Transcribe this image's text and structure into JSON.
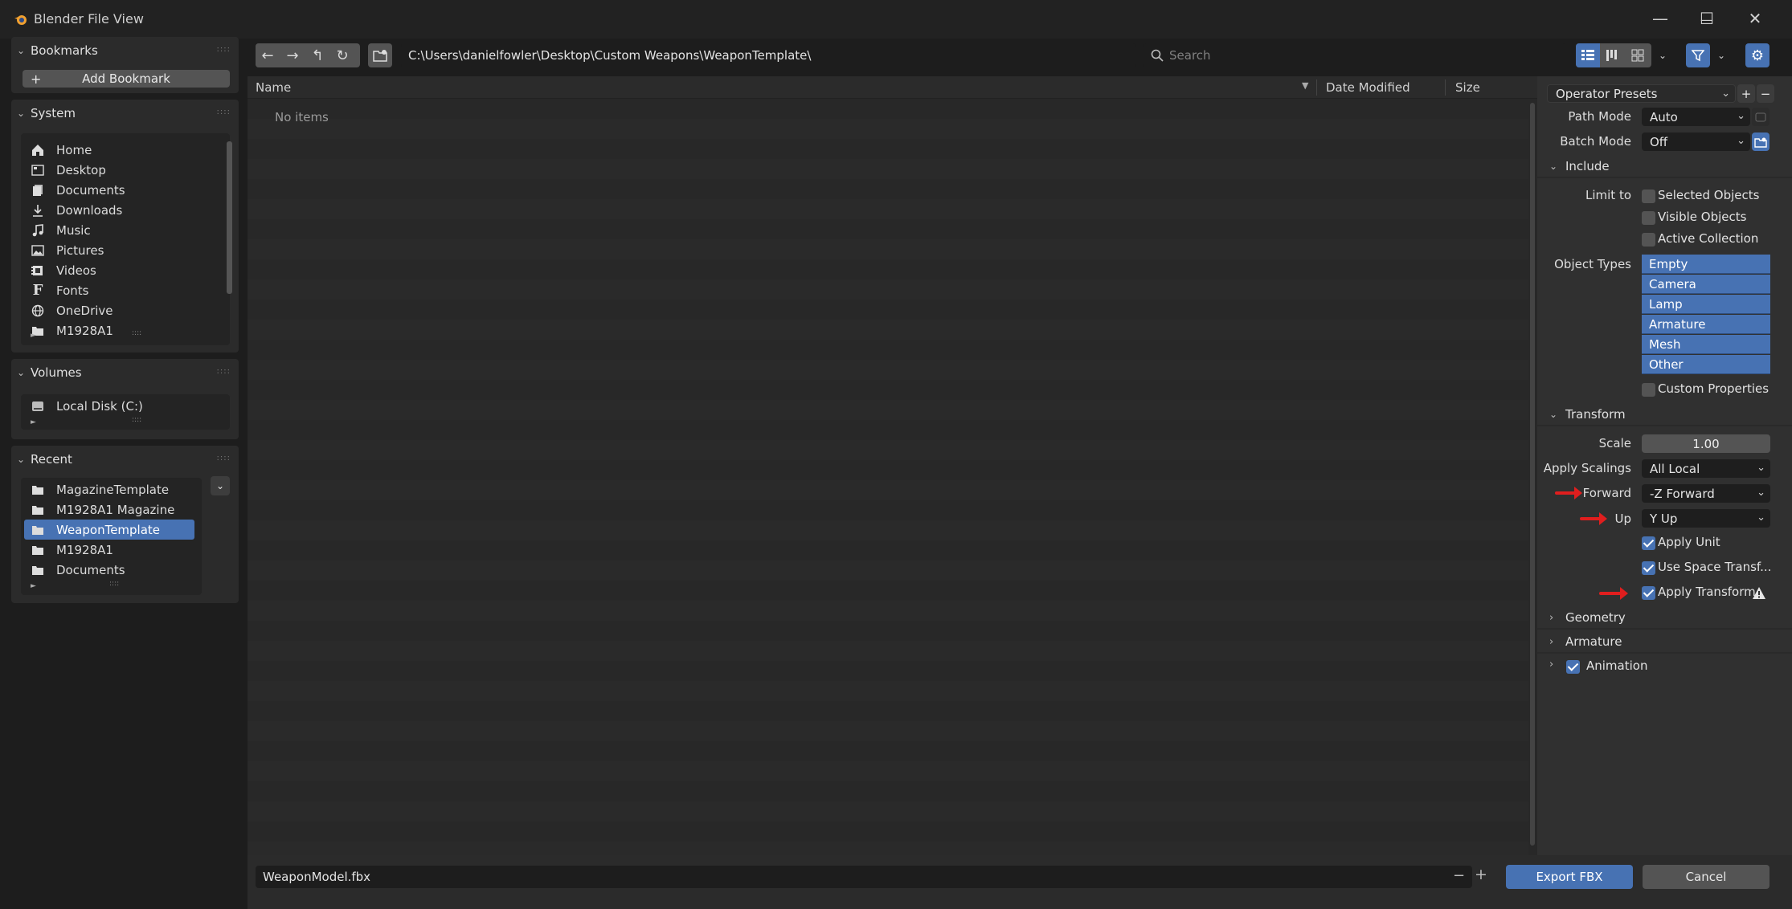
{
  "window": {
    "title": "Blender File View",
    "minimize": "—",
    "maximize": "☐",
    "close": "✕"
  },
  "bookmarks": {
    "title": "Bookmarks",
    "add_label": "Add Bookmark"
  },
  "system": {
    "title": "System",
    "items": [
      {
        "label": "Home",
        "icon": "home-icon"
      },
      {
        "label": "Desktop",
        "icon": "desktop-icon"
      },
      {
        "label": "Documents",
        "icon": "documents-icon"
      },
      {
        "label": "Downloads",
        "icon": "download-icon"
      },
      {
        "label": "Music",
        "icon": "music-icon"
      },
      {
        "label": "Pictures",
        "icon": "image-icon"
      },
      {
        "label": "Videos",
        "icon": "video-icon"
      },
      {
        "label": "Fonts",
        "icon": "font-icon"
      },
      {
        "label": "OneDrive",
        "icon": "globe-icon"
      },
      {
        "label": "M1928A1",
        "icon": "folder-icon"
      }
    ]
  },
  "volumes": {
    "title": "Volumes",
    "items": [
      {
        "label": "Local Disk (C:)",
        "icon": "disk-icon"
      }
    ]
  },
  "recent": {
    "title": "Recent",
    "items": [
      {
        "label": "MagazineTemplate",
        "selected": false
      },
      {
        "label": "M1928A1 Magazine",
        "selected": false
      },
      {
        "label": "WeaponTemplate",
        "selected": true
      },
      {
        "label": "M1928A1",
        "selected": false
      },
      {
        "label": "Documents",
        "selected": false
      }
    ]
  },
  "toolbar": {
    "path": "C:\\Users\\danielfowler\\Desktop\\Custom Weapons\\WeaponTemplate\\",
    "search_placeholder": "Search"
  },
  "filelist": {
    "col_name": "Name",
    "col_date": "Date Modified",
    "col_size": "Size",
    "empty_text": "No items"
  },
  "options": {
    "presets_label": "Operator Presets",
    "path_mode_label": "Path Mode",
    "path_mode_value": "Auto",
    "batch_mode_label": "Batch Mode",
    "batch_mode_value": "Off",
    "include_title": "Include",
    "limit_to_label": "Limit to",
    "selected_objects": "Selected Objects",
    "visible_objects": "Visible Objects",
    "active_collection": "Active Collection",
    "object_types_label": "Object Types",
    "object_types": [
      "Empty",
      "Camera",
      "Lamp",
      "Armature",
      "Mesh",
      "Other"
    ],
    "custom_properties": "Custom Properties",
    "transform_title": "Transform",
    "scale_label": "Scale",
    "scale_value": "1.00",
    "apply_scalings_label": "Apply Scalings",
    "apply_scalings_value": "All Local",
    "forward_label": "Forward",
    "forward_value": "-Z Forward",
    "up_label": "Up",
    "up_value": "Y Up",
    "apply_unit": "Apply Unit",
    "use_space_transform": "Use Space Transf...",
    "apply_transform": "Apply Transform",
    "geometry_title": "Geometry",
    "armature_title": "Armature",
    "animation_title": "Animation"
  },
  "footer": {
    "filename": "WeaponModel.fbx",
    "export_label": "Export FBX",
    "cancel_label": "Cancel"
  },
  "colors": {
    "accent": "#4772b3",
    "annotation": "#e01e1e"
  }
}
